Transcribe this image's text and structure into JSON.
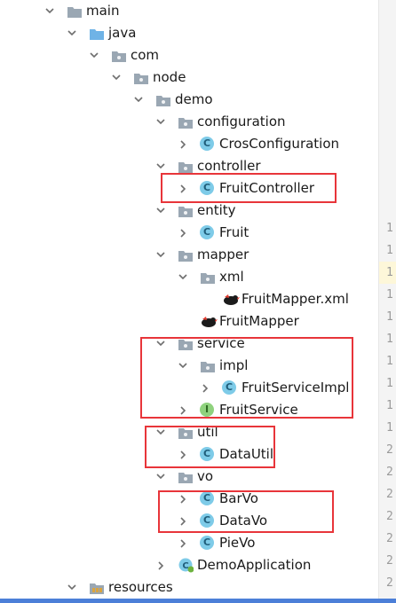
{
  "tree": [
    {
      "label": "main",
      "type": "folder",
      "expanded": true
    },
    {
      "label": "java",
      "type": "source-folder",
      "expanded": true
    },
    {
      "label": "com",
      "type": "package",
      "expanded": true
    },
    {
      "label": "node",
      "type": "package",
      "expanded": true
    },
    {
      "label": "demo",
      "type": "package",
      "expanded": true
    },
    {
      "label": "configuration",
      "type": "package",
      "expanded": true
    },
    {
      "label": "CrosConfiguration",
      "type": "class",
      "icon_letter": "C",
      "expanded": false
    },
    {
      "label": "controller",
      "type": "package",
      "expanded": true
    },
    {
      "label": "FruitController",
      "type": "class",
      "icon_letter": "C",
      "expanded": false
    },
    {
      "label": "entity",
      "type": "package",
      "expanded": true
    },
    {
      "label": "Fruit",
      "type": "class",
      "icon_letter": "C",
      "expanded": false
    },
    {
      "label": "mapper",
      "type": "package",
      "expanded": true
    },
    {
      "label": "xml",
      "type": "package",
      "expanded": true
    },
    {
      "label": "FruitMapper.xml",
      "type": "mybatis-xml"
    },
    {
      "label": "FruitMapper",
      "type": "mybatis-mapper"
    },
    {
      "label": "service",
      "type": "package",
      "expanded": true
    },
    {
      "label": "impl",
      "type": "package",
      "expanded": true
    },
    {
      "label": "FruitServiceImpl",
      "type": "class",
      "icon_letter": "C",
      "expanded": false
    },
    {
      "label": "FruitService",
      "type": "interface",
      "icon_letter": "I",
      "expanded": false
    },
    {
      "label": "util",
      "type": "package",
      "expanded": true
    },
    {
      "label": "DataUtil",
      "type": "class",
      "icon_letter": "C",
      "expanded": false
    },
    {
      "label": "vo",
      "type": "package",
      "expanded": true
    },
    {
      "label": "BarVo",
      "type": "class",
      "icon_letter": "C",
      "expanded": false
    },
    {
      "label": "DataVo",
      "type": "class",
      "icon_letter": "C",
      "expanded": false
    },
    {
      "label": "PieVo",
      "type": "class",
      "icon_letter": "C",
      "expanded": false
    },
    {
      "label": "DemoApplication",
      "type": "spring-app",
      "icon_letter": "C",
      "expanded": false
    },
    {
      "label": "resources",
      "type": "resources-folder",
      "expanded": true
    }
  ],
  "gutter_line_numbers": [
    "1",
    "1",
    "1",
    "1",
    "1",
    "1",
    "1",
    "1",
    "1",
    "1",
    "2",
    "2",
    "2",
    "2",
    "2",
    "2",
    "2"
  ],
  "colors": {
    "folder": "#9aa7b3",
    "source_folder": "#6fb3e6",
    "class_icon": "#7ecbe8",
    "interface_icon": "#8fd27e",
    "highlight_box": "#e8353a",
    "current_line": "#fdf7d9",
    "bottom_bar": "#4c7fd8"
  },
  "highlighted_items": [
    "FruitController",
    "service",
    "impl",
    "FruitServiceImpl",
    "FruitService",
    "util",
    "DataUtil",
    "BarVo",
    "DataVo"
  ]
}
